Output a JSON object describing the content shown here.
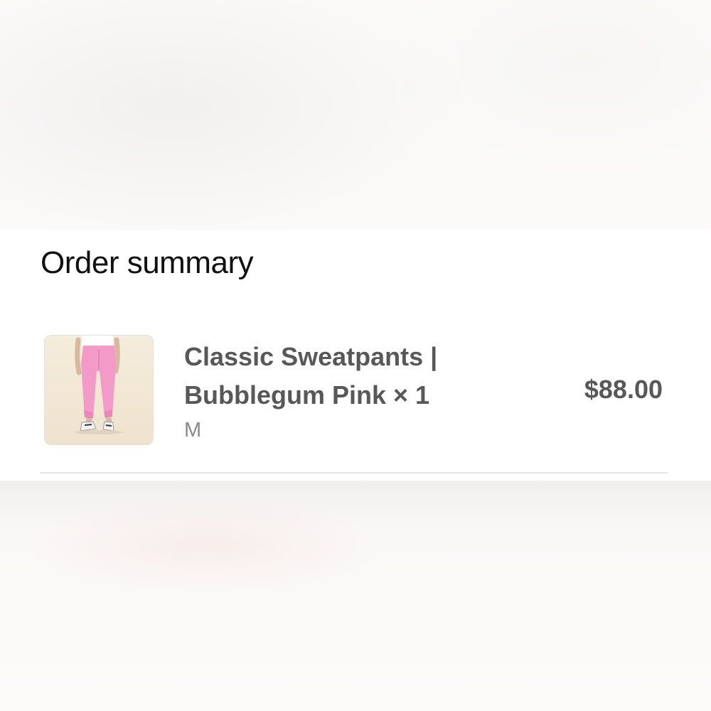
{
  "order_summary": {
    "title": "Order summary",
    "item": {
      "name_line1": "Classic Sweatpants |",
      "name_line2": "Bubblegum Pink × 1",
      "variant": "M",
      "price": "$88.00",
      "image_icon": "product-photo"
    }
  },
  "colors": {
    "text_primary": "#111111",
    "text_secondary": "#585858",
    "text_muted": "#8a8a8a",
    "divider": "#e4e4e4",
    "product_pink": "#f49ac8"
  }
}
